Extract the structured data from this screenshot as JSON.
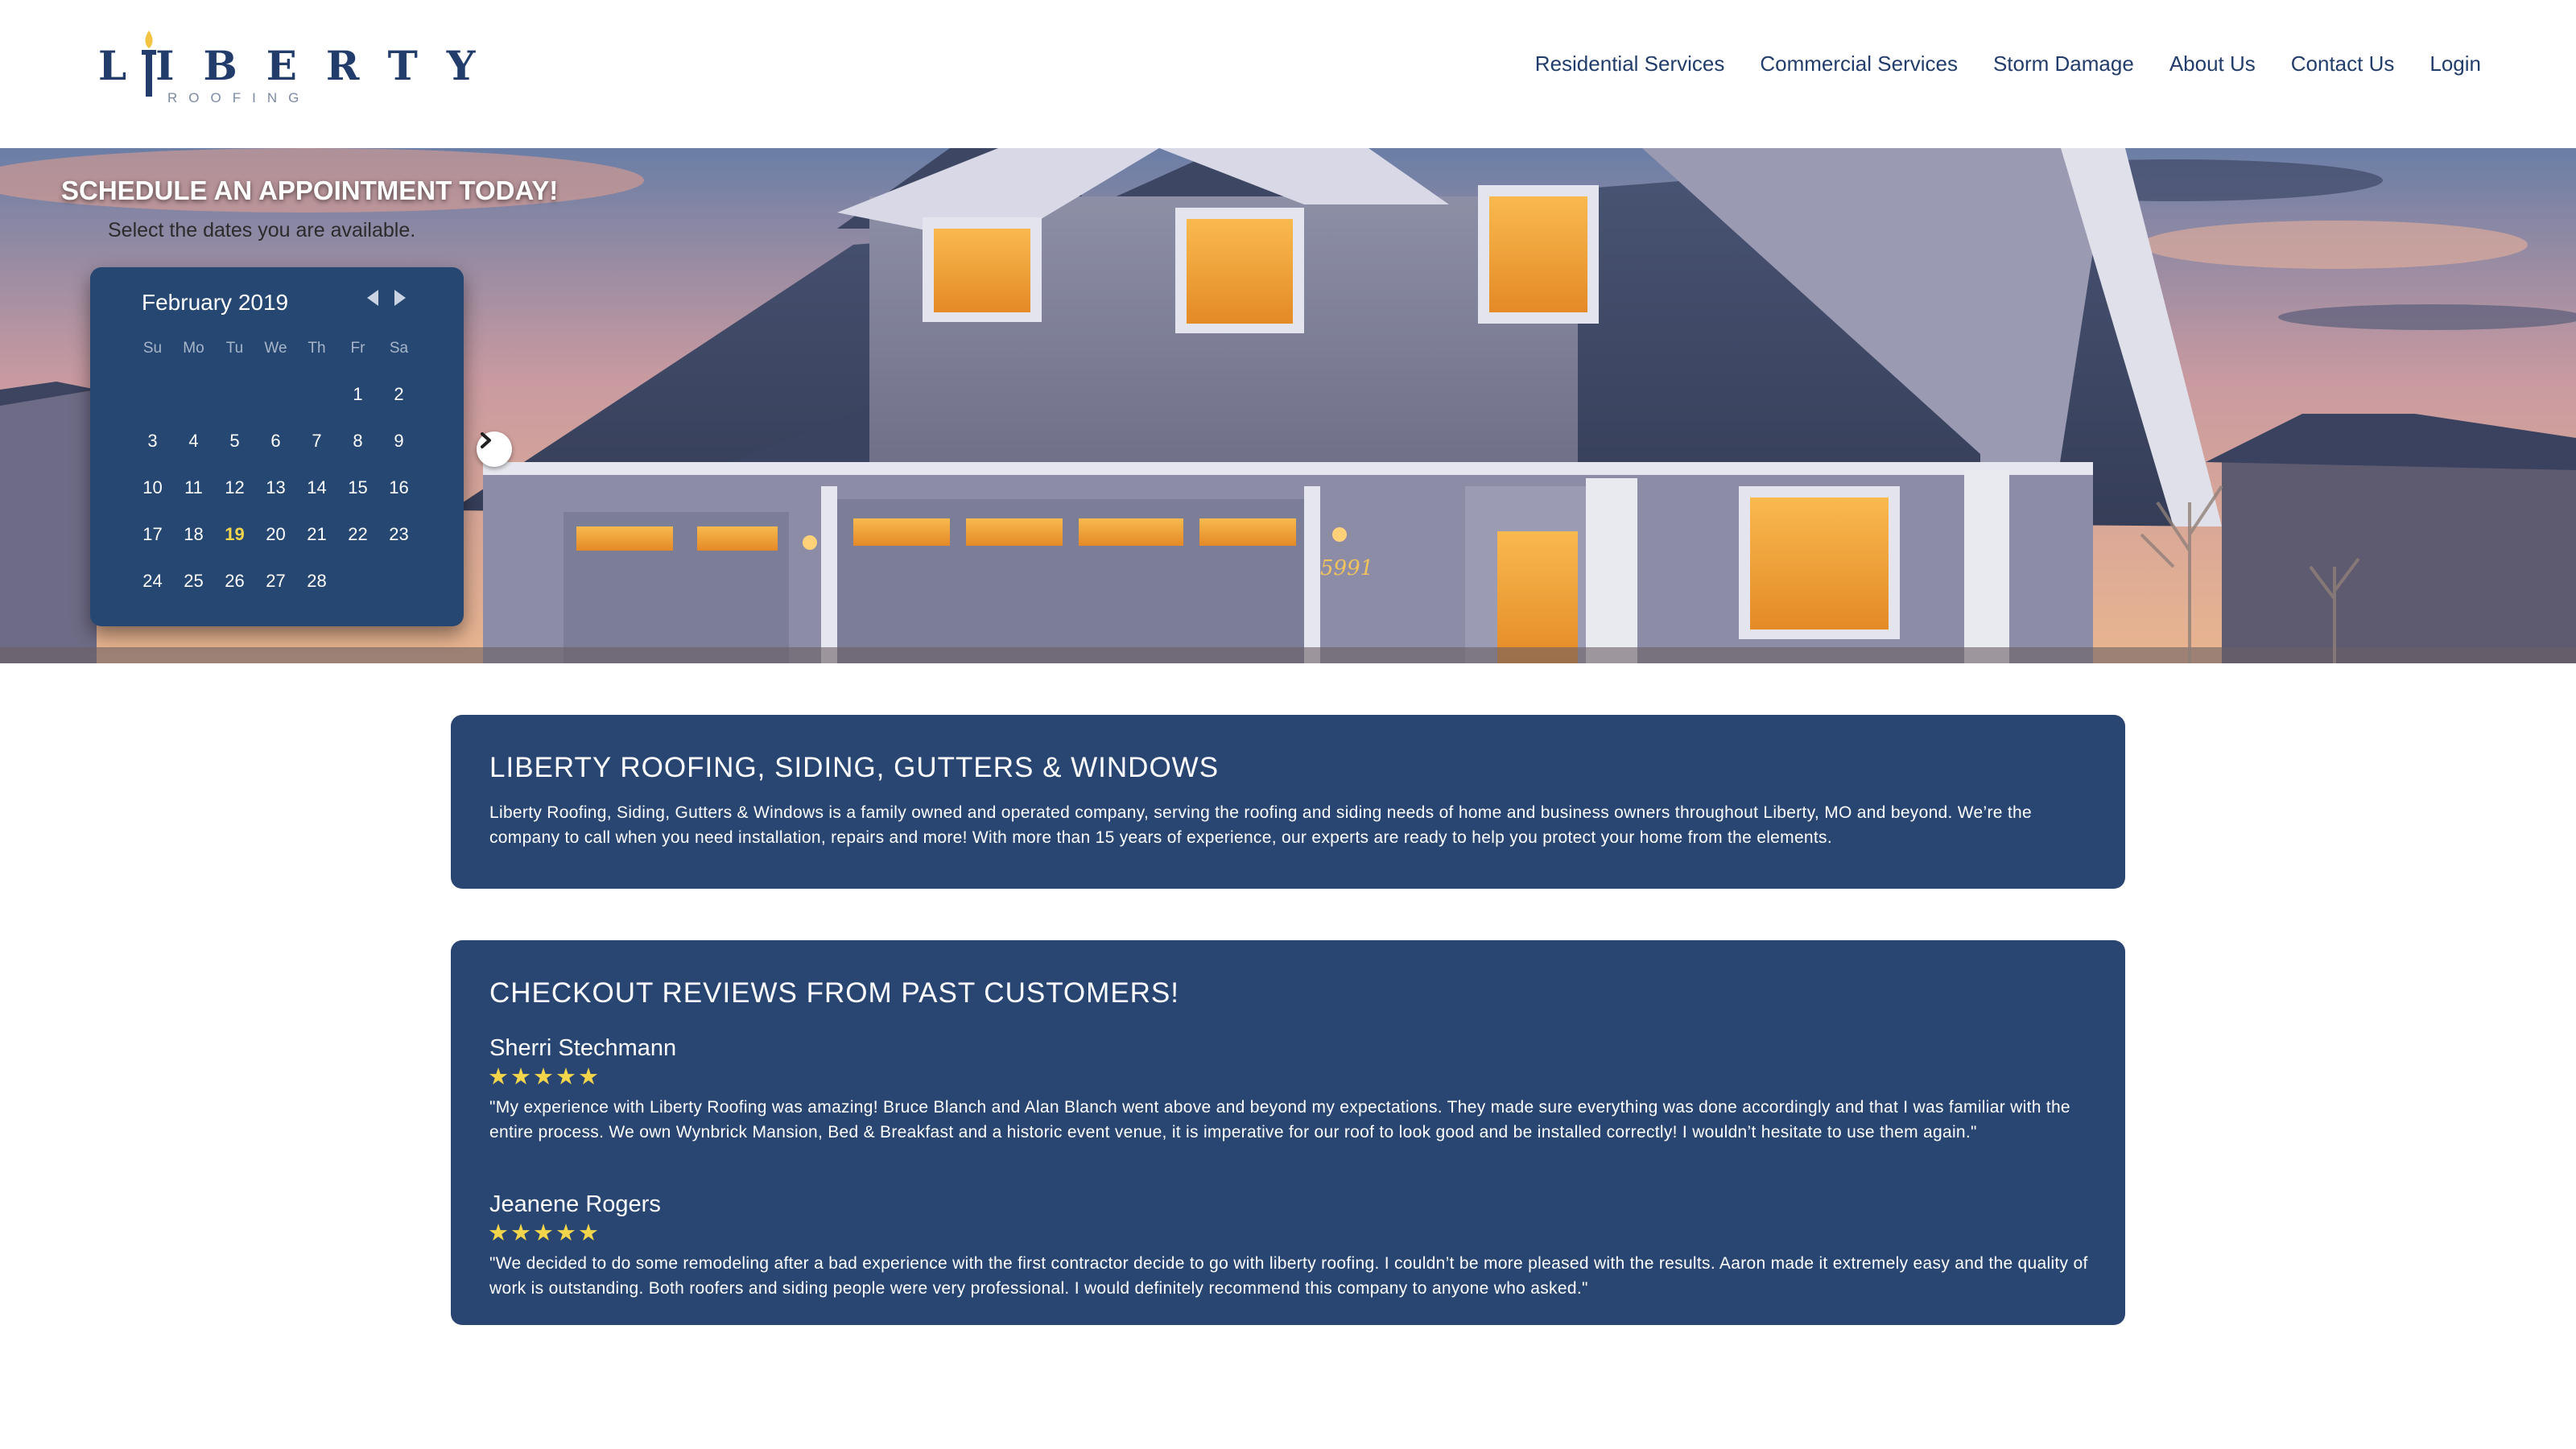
{
  "brand": {
    "name": "LIBERTY",
    "sub": "ROOFING",
    "navy": "#223d6b",
    "panel_color": "#284671",
    "accent_gold": "#f3d54b"
  },
  "nav": {
    "items": [
      "Residential Services",
      "Commercial Services",
      "Storm Damage",
      "About Us",
      "Contact Us",
      "Login"
    ]
  },
  "hero": {
    "schedule_title": "SCHEDULE AN APPOINTMENT TODAY!",
    "schedule_subtitle": "Select the dates you are available.",
    "house_number": "5991",
    "next_icon": "chevron-right-icon"
  },
  "calendar": {
    "month_label": "February 2019",
    "weekdays": [
      "Su",
      "Mo",
      "Tu",
      "We",
      "Th",
      "Fr",
      "Sa"
    ],
    "leading_blanks": 5,
    "days": [
      "1",
      "2",
      "3",
      "4",
      "5",
      "6",
      "7",
      "8",
      "9",
      "10",
      "11",
      "12",
      "13",
      "14",
      "15",
      "16",
      "17",
      "18",
      "19",
      "20",
      "21",
      "22",
      "23",
      "24",
      "25",
      "26",
      "27",
      "28"
    ],
    "today": "19",
    "prev_icon": "caret-left-icon",
    "next_icon": "caret-right-icon"
  },
  "about": {
    "title": "LIBERTY ROOFING, SIDING, GUTTERS & WINDOWS",
    "text": "Liberty Roofing, Siding, Gutters & Windows is a family owned and operated company, serving the roofing and siding needs of home and business owners throughout Liberty, MO and beyond. We’re the company to call when you need installation, repairs and more! With more than 15 years of experience, our experts are ready to help you protect your home from the elements."
  },
  "reviews": {
    "title": "CHECKOUT REVIEWS FROM PAST CUSTOMERS!",
    "items": [
      {
        "name": "Sherri Stechmann",
        "stars": "★★★★★",
        "rating": 5,
        "text": "\"My experience with Liberty Roofing was amazing! Bruce Blanch and Alan Blanch went above and beyond my expectations. They made sure everything was done accordingly and that I was familiar with the entire process. We own Wynbrick Mansion, Bed & Breakfast and a historic event venue, it is imperative for our roof to look good and be installed correctly! I wouldn’t hesitate to use them again.\""
      },
      {
        "name": "Jeanene Rogers",
        "stars": "★★★★★",
        "rating": 5,
        "text": "\"We decided to do some remodeling after a bad experience with the first contractor decide to go with liberty roofing. I couldn’t be more pleased with the results. Aaron made it extremely easy and the quality of work is outstanding. Both roofers and siding people were very professional. I would definitely recommend this company to anyone who asked.\""
      }
    ]
  }
}
